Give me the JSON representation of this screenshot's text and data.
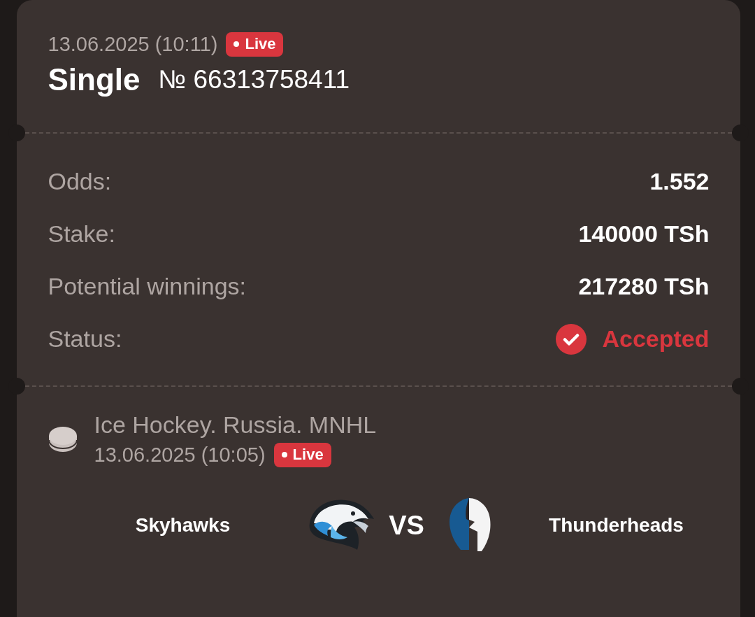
{
  "ticket": {
    "date": "13.06.2025 (10:11)",
    "badge": "Live",
    "type": "Single",
    "number": "№ 66313758411"
  },
  "details": [
    {
      "label": "Odds:",
      "value": "1.552",
      "kind": "plain"
    },
    {
      "label": "Stake:",
      "value": "140000 TSh",
      "kind": "plain"
    },
    {
      "label": "Potential winnings:",
      "value": "217280 TSh",
      "kind": "plain"
    },
    {
      "label": "Status:",
      "value": "Accepted",
      "kind": "status"
    }
  ],
  "event": {
    "league": "Ice Hockey. Russia. MNHL",
    "date": "13.06.2025 (10:05)",
    "badge": "Live",
    "home": "Skyhawks",
    "separator": "VS",
    "away": "Thunderheads"
  }
}
